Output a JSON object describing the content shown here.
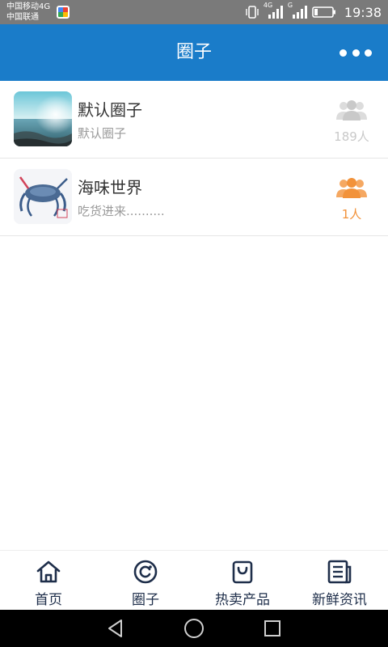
{
  "status": {
    "carrier_line1": "中国移动4G",
    "carrier_line2": "中国联通",
    "time": "19:38",
    "network1": "4G",
    "network2": "G"
  },
  "header": {
    "title": "圈子",
    "more_icon": "more-dots-icon"
  },
  "circles": [
    {
      "name": "默认圈子",
      "description": "默认圈子",
      "members": "189人",
      "member_color": "#c9c9c9",
      "thumb": "sea-photo"
    },
    {
      "name": "海味世界",
      "description": "吃货进来..........",
      "members": "1人",
      "member_color": "#f2923a",
      "thumb": "crab-photo"
    }
  ],
  "tabs": [
    {
      "label": "首页",
      "icon": "home-icon"
    },
    {
      "label": "圈子",
      "icon": "circle-c-icon"
    },
    {
      "label": "热卖产品",
      "icon": "shopping-bag-icon"
    },
    {
      "label": "新鲜资讯",
      "icon": "news-icon"
    }
  ],
  "colors": {
    "accent": "#1a7cc9",
    "tab_icon": "#1e2e4a",
    "active_members": "#f2923a",
    "inactive_members": "#c9c9c9"
  },
  "system_nav": [
    "back-icon",
    "home-circle-icon",
    "recents-square-icon"
  ]
}
